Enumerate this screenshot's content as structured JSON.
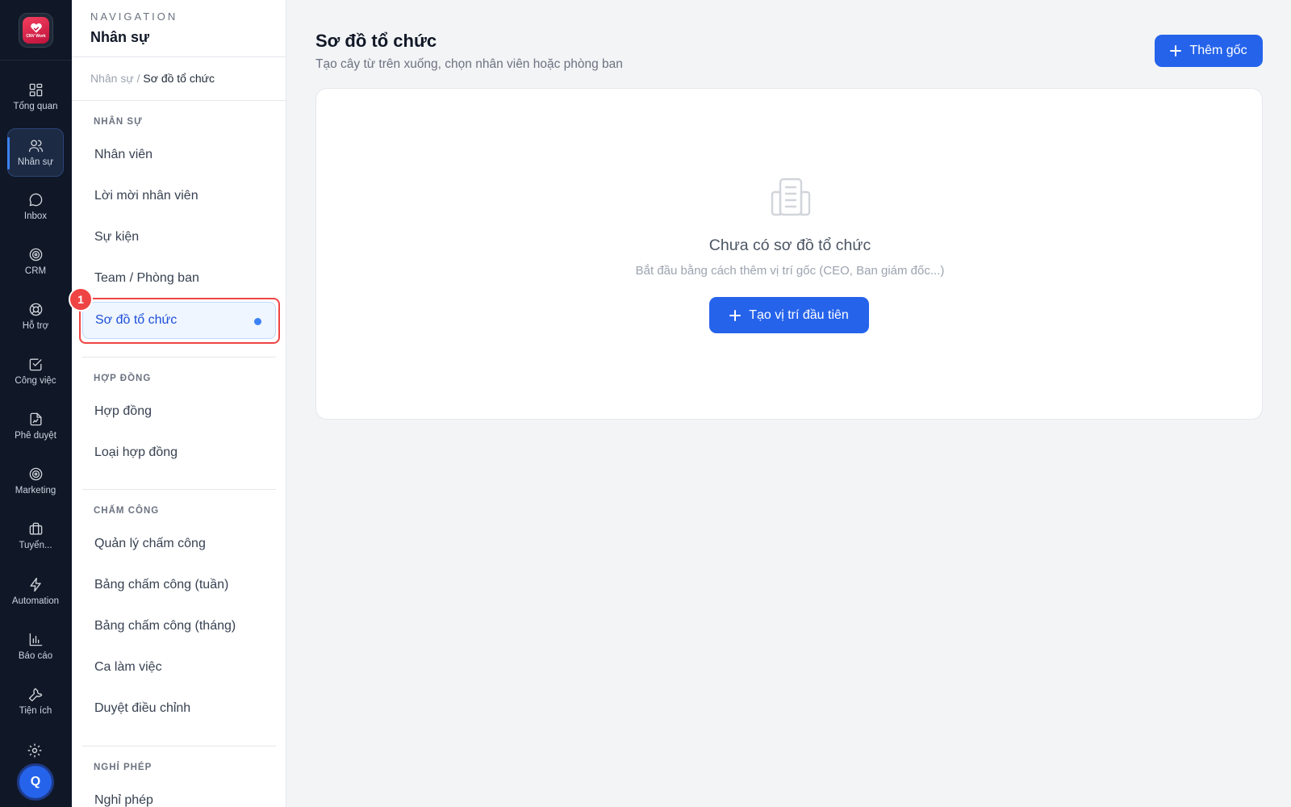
{
  "app": {
    "logo_text": "CNV Work",
    "avatar_initial": "Q"
  },
  "rail": {
    "items": [
      {
        "label": "Tổng quan",
        "icon": "grid-icon"
      },
      {
        "label": "Nhân sự",
        "icon": "users-icon",
        "active": true
      },
      {
        "label": "Inbox",
        "icon": "chat-icon"
      },
      {
        "label": "CRM",
        "icon": "target-icon"
      },
      {
        "label": "Hỗ trợ",
        "icon": "lifebuoy-icon"
      },
      {
        "label": "Công việc",
        "icon": "checkbox-icon"
      },
      {
        "label": "Phê duyệt",
        "icon": "file-sign-icon"
      },
      {
        "label": "Marketing",
        "icon": "target-icon"
      },
      {
        "label": "Tuyển...",
        "icon": "briefcase-icon"
      },
      {
        "label": "Automation",
        "icon": "bolt-icon"
      },
      {
        "label": "Báo cáo",
        "icon": "bar-chart-icon"
      },
      {
        "label": "Tiện ích",
        "icon": "wrench-icon"
      }
    ]
  },
  "subnav": {
    "eyebrow": "NAVIGATION",
    "title": "Nhân sự",
    "breadcrumb": {
      "parent": "Nhân sự /",
      "current": "Sơ đồ tổ chức"
    },
    "sections": [
      {
        "label": "NHÂN SỰ",
        "items": [
          "Nhân viên",
          "Lời mời nhân viên",
          "Sự kiện",
          "Team / Phòng ban",
          "Sơ đồ tổ chức"
        ]
      },
      {
        "label": "HỢP ĐỒNG",
        "items": [
          "Hợp đồng",
          "Loại hợp đồng"
        ]
      },
      {
        "label": "CHẤM CÔNG",
        "items": [
          "Quản lý chấm công",
          "Bảng chấm công (tuần)",
          "Bảng chấm công (tháng)",
          "Ca làm việc",
          "Duyệt điều chỉnh"
        ]
      },
      {
        "label": "NGHỈ PHÉP",
        "items": [
          "Nghỉ phép"
        ]
      }
    ],
    "step_badge": "1"
  },
  "main": {
    "title": "Sơ đồ tổ chức",
    "subtitle": "Tạo cây từ trên xuống, chọn nhân viên hoặc phòng ban",
    "add_root_label": "Thêm gốc",
    "empty_state": {
      "title": "Chưa có sơ đồ tổ chức",
      "subtitle": "Bắt đầu bằng cách thêm vị trí gốc (CEO, Ban giám đốc...)",
      "button_label": "Tạo vị trí đầu tiên",
      "icon": "building-icon"
    }
  },
  "colors": {
    "rail_bg": "#101827",
    "accent": "#2563eb",
    "highlight": "#ef4444"
  }
}
